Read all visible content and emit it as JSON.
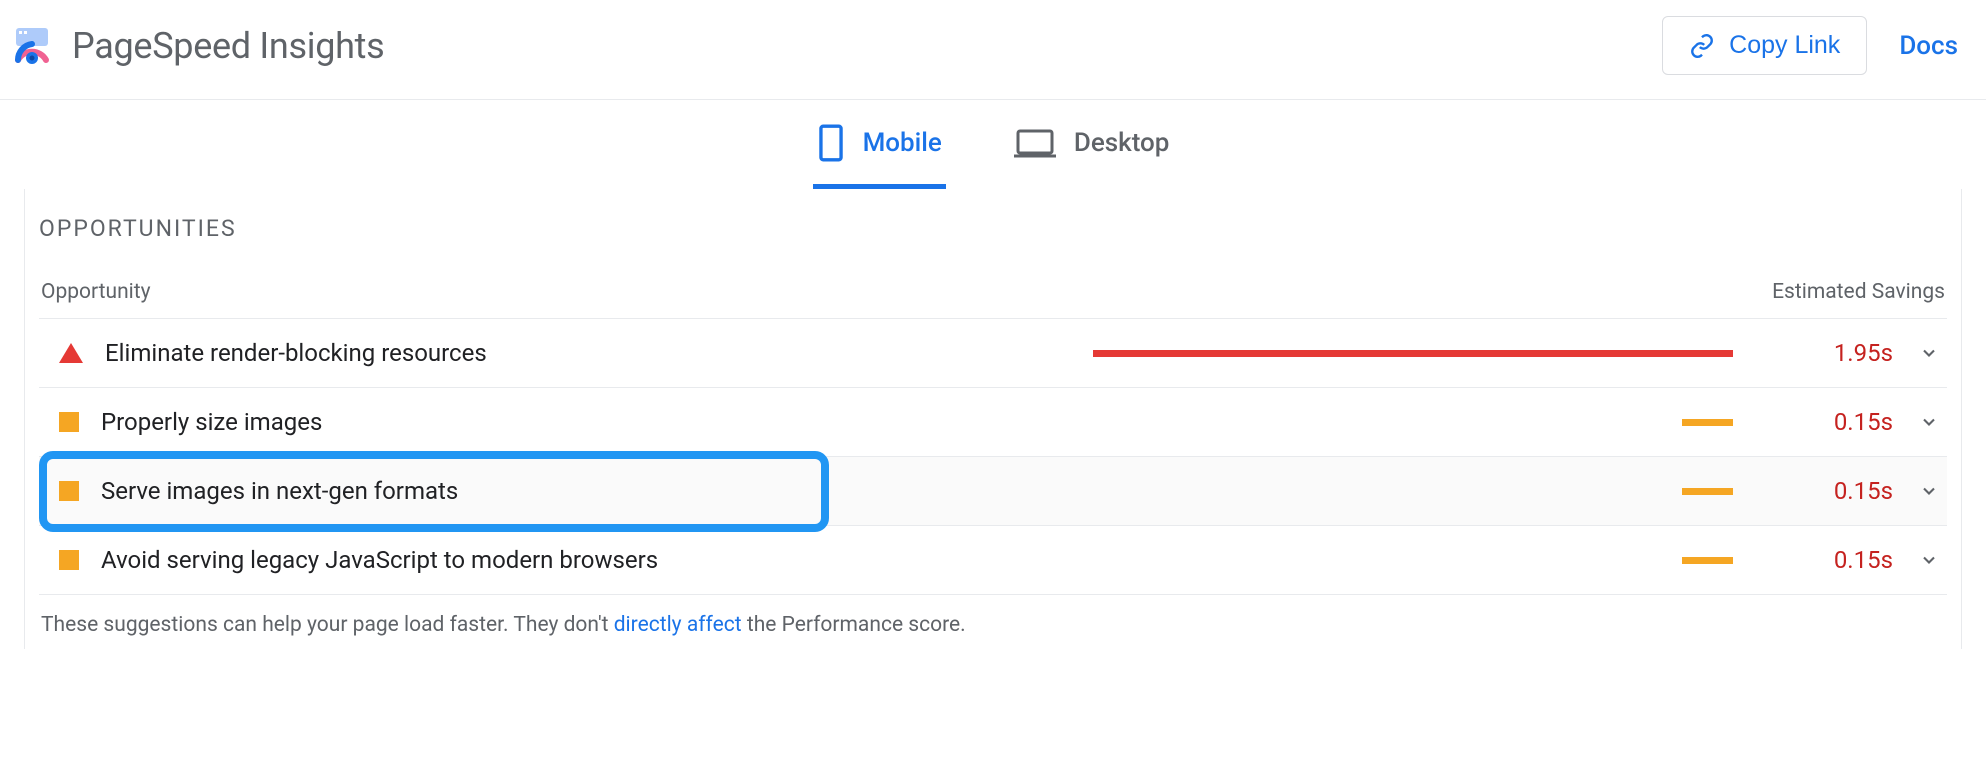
{
  "header": {
    "title": "PageSpeed Insights",
    "copy_link_label": "Copy Link",
    "docs_label": "Docs"
  },
  "tabs": {
    "mobile": "Mobile",
    "desktop": "Desktop",
    "active": "mobile"
  },
  "opportunities": {
    "title": "OPPORTUNITIES",
    "col_opportunity": "Opportunity",
    "col_savings": "Estimated Savings",
    "rows": [
      {
        "status": "fail",
        "label": "Eliminate render-blocking resources",
        "savings": "1.95s",
        "bar_pct": 100,
        "bar_color": "red"
      },
      {
        "status": "avg",
        "label": "Properly size images",
        "savings": "0.15s",
        "bar_pct": 8,
        "bar_color": "orange"
      },
      {
        "status": "avg",
        "label": "Serve images in next-gen formats",
        "savings": "0.15s",
        "bar_pct": 8,
        "bar_color": "orange",
        "highlighted": true
      },
      {
        "status": "avg",
        "label": "Avoid serving legacy JavaScript to modern browsers",
        "savings": "0.15s",
        "bar_pct": 8,
        "bar_color": "orange"
      }
    ],
    "footer_prefix": "These suggestions can help your page load faster. They don't ",
    "footer_link": "directly affect",
    "footer_suffix": " the Performance score."
  }
}
